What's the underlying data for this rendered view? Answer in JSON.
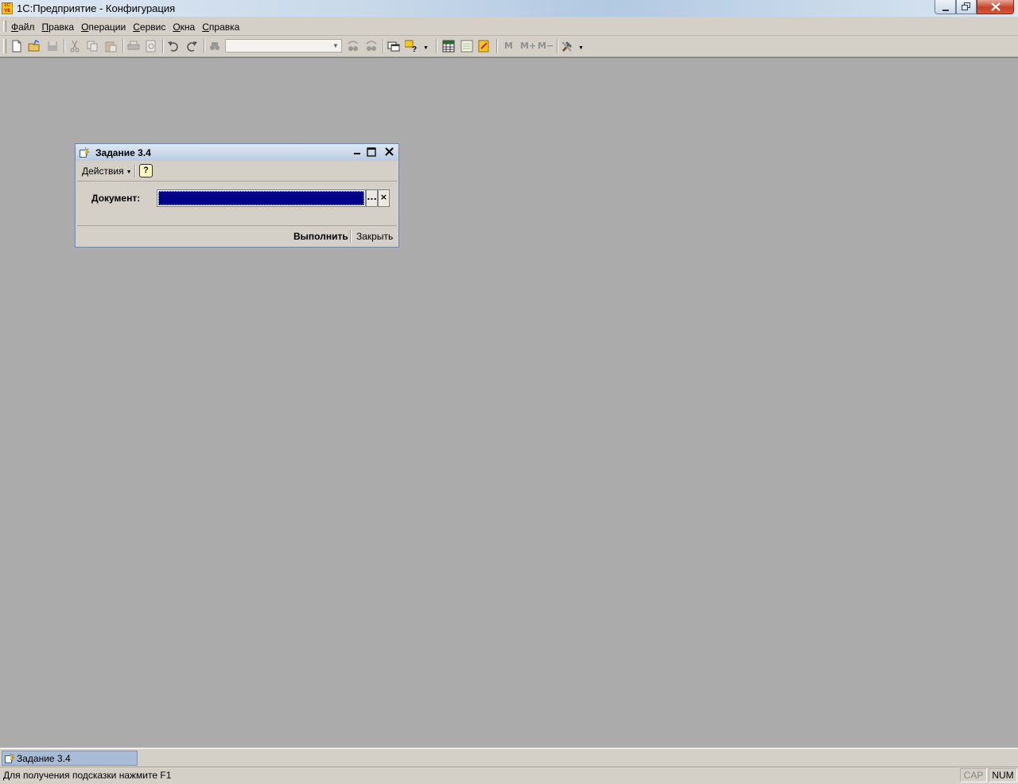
{
  "app": {
    "title": "1С:Предприятие - Конфигурация",
    "icon_text": "1C V8"
  },
  "menu": {
    "items": [
      {
        "label": "Файл",
        "mnemonic": "Ф"
      },
      {
        "label": "Правка",
        "mnemonic": "П"
      },
      {
        "label": "Операции",
        "mnemonic": "О"
      },
      {
        "label": "Сервис",
        "mnemonic": "С"
      },
      {
        "label": "Окна",
        "mnemonic": "О"
      },
      {
        "label": "Справка",
        "mnemonic": "С"
      }
    ]
  },
  "toolbar": {
    "search_value": "",
    "memory_buttons": [
      "M",
      "M+",
      "M−"
    ]
  },
  "dialog": {
    "title": "Задание 3.4",
    "actions_label": "Действия",
    "help_label": "?",
    "field_label": "Документ:",
    "field_value": "",
    "select_btn": "...",
    "clear_btn": "×",
    "run_label": "Выполнить",
    "close_label": "Закрыть"
  },
  "window_tabs": [
    {
      "label": "Задание 3.4",
      "active": true
    }
  ],
  "status": {
    "hint": "Для получения подсказки нажмите F1",
    "cap": "CAP",
    "num": "NUM"
  },
  "colors": {
    "workspace": "#ababab",
    "chrome": "#d4d0c8",
    "selection": "#00008b",
    "active_tab": "#a9bcd6"
  }
}
